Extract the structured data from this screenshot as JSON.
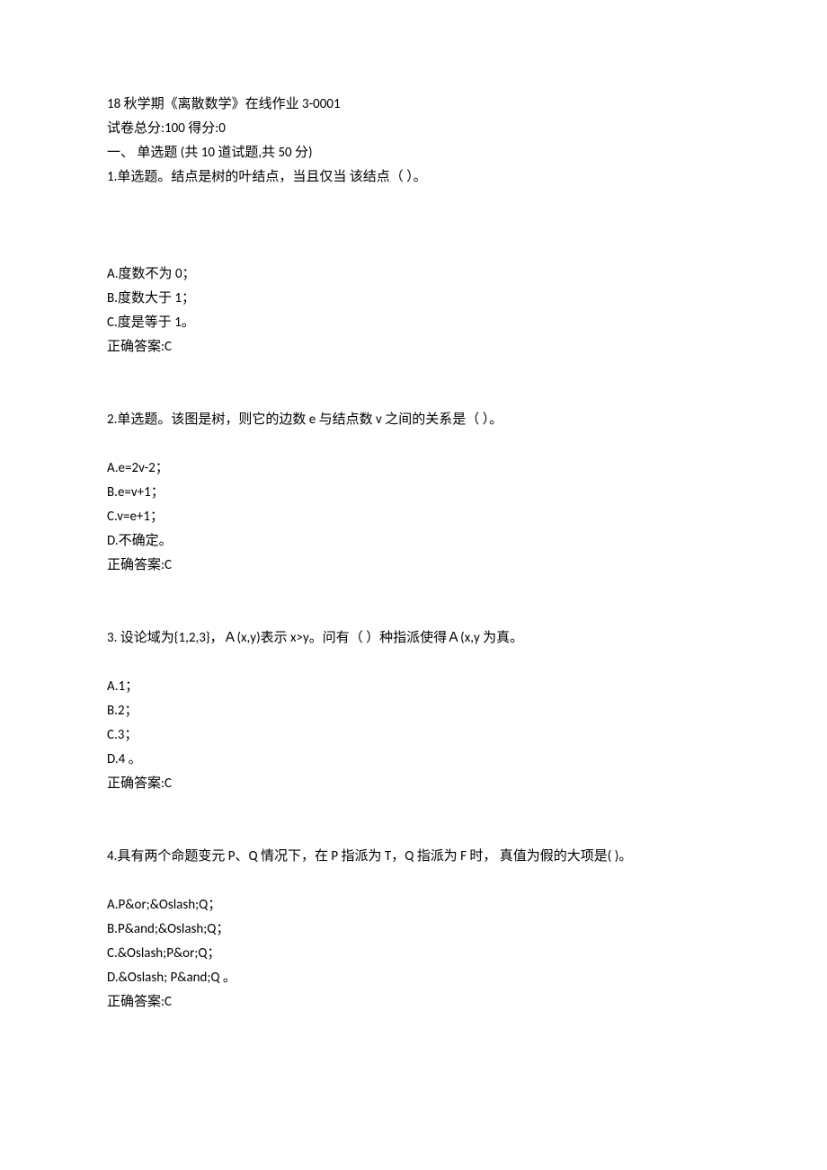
{
  "header": {
    "title": "18 秋学期《离散数学》在线作业 3-0001",
    "scoreline": "试卷总分:100       得分:0",
    "sectionline": "一、  单选题  (共  10  道试题,共  50  分)"
  },
  "q1": {
    "stem": "1.单选题。结点是树的叶结点，当且仅当  该结点（                  ）。",
    "optA": "A.度数不为 0；",
    "optB": "B.度数大于 1；",
    "optC": "C.度是等于 1。",
    "answer": "正确答案:C"
  },
  "q2": {
    "stem": "2.单选题。该图是树，则它的边数 e 与结点数 v 之间的关系是（             ）。",
    "optA": "A.e=2v-2；",
    "optB": "B.e=v+1；",
    "optC": "C.v=e+1；",
    "optD": "D.不确定。",
    "answer": "正确答案:C"
  },
  "q3": {
    "stem": "3.  设论域为{1,2,3}，Ａ(x,y)表示  x>y。问有（       ）种指派使得Ａ(x,y 为真。",
    "optA": "A.1；",
    "optB": "B.2；",
    "optC": "C.3；",
    "optD": "D.4  。",
    "answer": "正确答案:C"
  },
  "q4": {
    "stem": "4.具有两个命题变元 P、Q 情况下，在 P 指派为 T，Q 指派为 F 时， 真值为假的大项是(            )。",
    "optA": "A.P&or;&Oslash;Q；",
    "optB": "B.P&and;&Oslash;Q；",
    "optC": "C.&Oslash;P&or;Q；",
    "optD": "D.&Oslash; P&and;Q  。",
    "answer": "正确答案:C"
  }
}
